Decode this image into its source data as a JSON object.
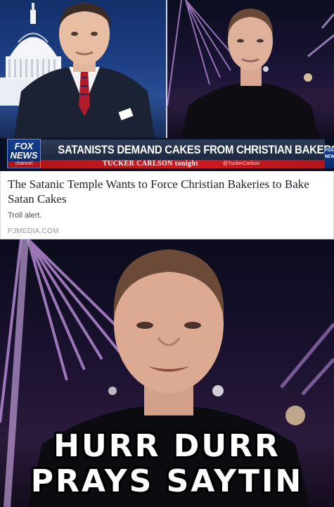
{
  "broadcast": {
    "logo_line1": "FOX",
    "logo_line2": "NEWS",
    "logo_line3": "channel",
    "headline": "SATANISTS DEMAND CAKES FROM CHRISTIAN BAKERS",
    "show_name": "TUCKER CARLSON tonight",
    "handle": "@TuckerCarlson",
    "right_logo": "FOX NEW"
  },
  "article": {
    "title": "The Satanic Temple Wants to Force Christian Bakeries to Bake Satan Cakes",
    "description": "Troll alert.",
    "source": "PJMEDIA.COM"
  },
  "meme": {
    "line1": "HURR DURR",
    "line2": "PRAYS SAYTIN"
  },
  "colors": {
    "lower_third_red": "#d21a22",
    "lower_third_navy": "#1d2740",
    "caption_text": "#ffffff"
  }
}
